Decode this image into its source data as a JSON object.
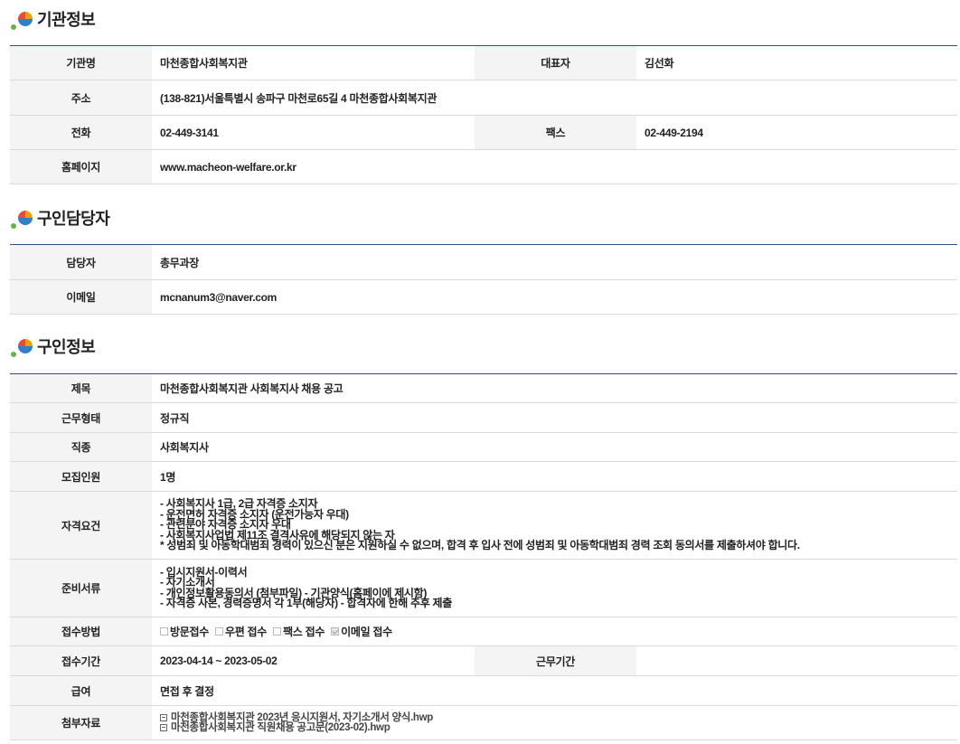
{
  "sections": {
    "org": {
      "title": "기관정보",
      "name_label": "기관명",
      "name_value": "마천종합사회복지관",
      "rep_label": "대표자",
      "rep_value": "김선화",
      "addr_label": "주소",
      "addr_value": "(138-821)서울특별시 송파구 마천로65길 4 마천종합사회복지관",
      "phone_label": "전화",
      "phone_value": "02-449-3141",
      "fax_label": "팩스",
      "fax_value": "02-449-2194",
      "home_label": "홈페이지",
      "home_value": "www.macheon-welfare.or.kr"
    },
    "contact": {
      "title": "구인담당자",
      "person_label": "담당자",
      "person_value": "총무과장",
      "email_label": "이메일",
      "email_value": "mcnanum3@naver.com"
    },
    "job": {
      "title": "구인정보",
      "subject_label": "제목",
      "subject_value": "마천종합사회복지관 사회복지사 채용 공고",
      "type_label": "근무형태",
      "type_value": "정규직",
      "occupation_label": "직종",
      "occupation_value": "사회복지사",
      "count_label": "모집인원",
      "count_value": "1명",
      "qual_label": "자격요건",
      "qual_lines": [
        "- 사회복지사 1급, 2급 자격증 소지자",
        "- 운전면허 자격증 소지자 (운전가능자 우대)",
        "- 관련분야 자격증 소지자 우대",
        "- 사회복지사업법 제11조 결격사유에 해당되지 않는 자",
        "* 성범죄 및 아동학대범죄 경력이 있으신 분은 지원하실 수 없으며, 합격 후 입사 전에 성범죄 및 아동학대범죄 경력 조회 동의서를 제출하셔야 합니다."
      ],
      "docs_label": "준비서류",
      "docs_lines": [
        "- 입시지원서-이력서",
        "- 자기소개서",
        "- 개인정보활용동의서 (첨부파일) - 기관양식(홈페이에 제시함)",
        "- 자격증 사본, 경력증명서 각 1부(해당자) - 합격자에 한해 추후 제출"
      ],
      "method_label": "접수방법",
      "methods": [
        {
          "label": "방문접수",
          "checked": false
        },
        {
          "label": "우편 접수",
          "checked": false
        },
        {
          "label": "팩스 접수",
          "checked": false
        },
        {
          "label": "이메일 접수",
          "checked": true
        }
      ],
      "period_label": "접수기간",
      "period_value": "2023-04-14 ~ 2023-05-02",
      "workperiod_label": "근무기간",
      "workperiod_value": "",
      "salary_label": "급여",
      "salary_value": "면접 후 결정",
      "attach_label": "첨부자료",
      "attachments": [
        "마천종합사회복지관 2023년 응시지원서, 자기소개서 양식.hwp",
        "마천종합사회복지관 직원채용 공고문(2023-02).hwp"
      ]
    }
  }
}
